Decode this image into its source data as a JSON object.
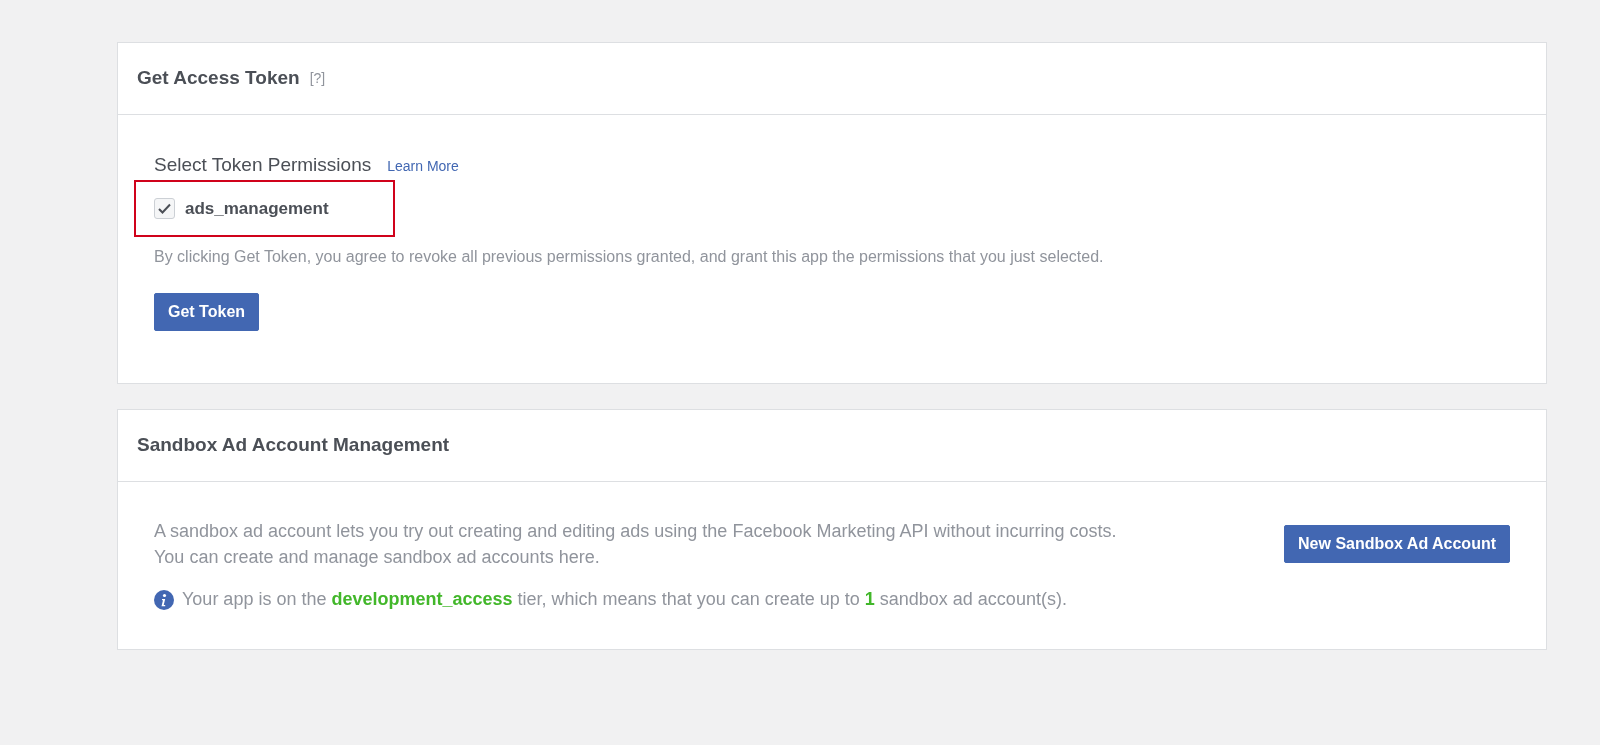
{
  "token_panel": {
    "title": "Get Access Token",
    "help": "[?]",
    "section_title": "Select Token Permissions",
    "learn_more": "Learn More",
    "permissions": [
      {
        "label": "ads_management",
        "checked": true,
        "highlighted": true
      }
    ],
    "notice": "By clicking Get Token, you agree to revoke all previous permissions granted, and grant this app the permissions that you just selected.",
    "button": "Get Token"
  },
  "sandbox_panel": {
    "title": "Sandbox Ad Account Management",
    "description": "A sandbox ad account lets you try out creating and editing ads using the Facebook Marketing API without incurring costs. You can create and manage sandbox ad accounts here.",
    "button": "New Sandbox Ad Account",
    "info": "Your app is on the **development_access** tier, which means that you can create up to **1** sandbox ad account(s)."
  }
}
